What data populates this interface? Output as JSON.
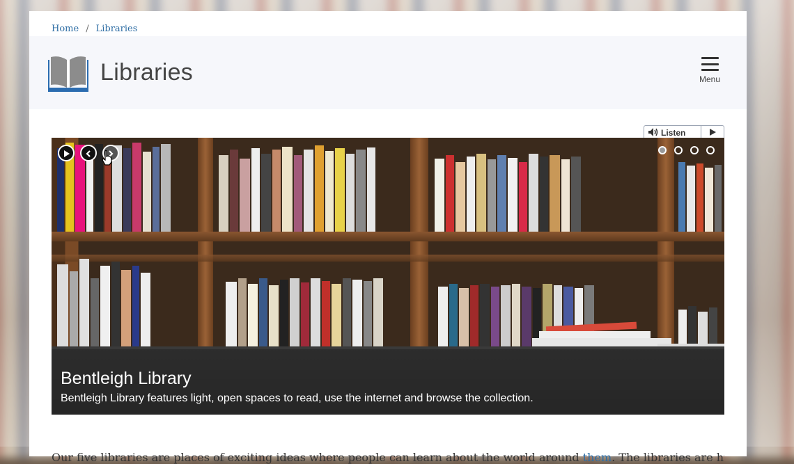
{
  "breadcrumb": {
    "home": "Home",
    "separator": "/",
    "current": "Libraries"
  },
  "header": {
    "title": "Libraries",
    "logo_icon": "open-book-icon",
    "menu_label": "Menu"
  },
  "listen": {
    "label": "Listen",
    "speaker_icon": "speaker-icon",
    "play_icon": "play-icon"
  },
  "slideshow": {
    "controls": [
      "play-icon",
      "chevron-left-icon",
      "chevron-right-icon"
    ],
    "slide_count": 4,
    "active_slide": 1,
    "caption_title": "Bentleigh Library",
    "caption_text": "Bentleigh Library features light, open spaces to read, use the internet and browse the collection."
  },
  "intro": {
    "text_start": "Our five libraries are places of exciting ideas where people can learn about the world around ",
    "link": "them",
    "text_end": ". The libraries are hub"
  },
  "colors": {
    "link": "#2e6da4",
    "logo_blue": "#2b6cb0",
    "header_bg": "#f6f7fb"
  }
}
